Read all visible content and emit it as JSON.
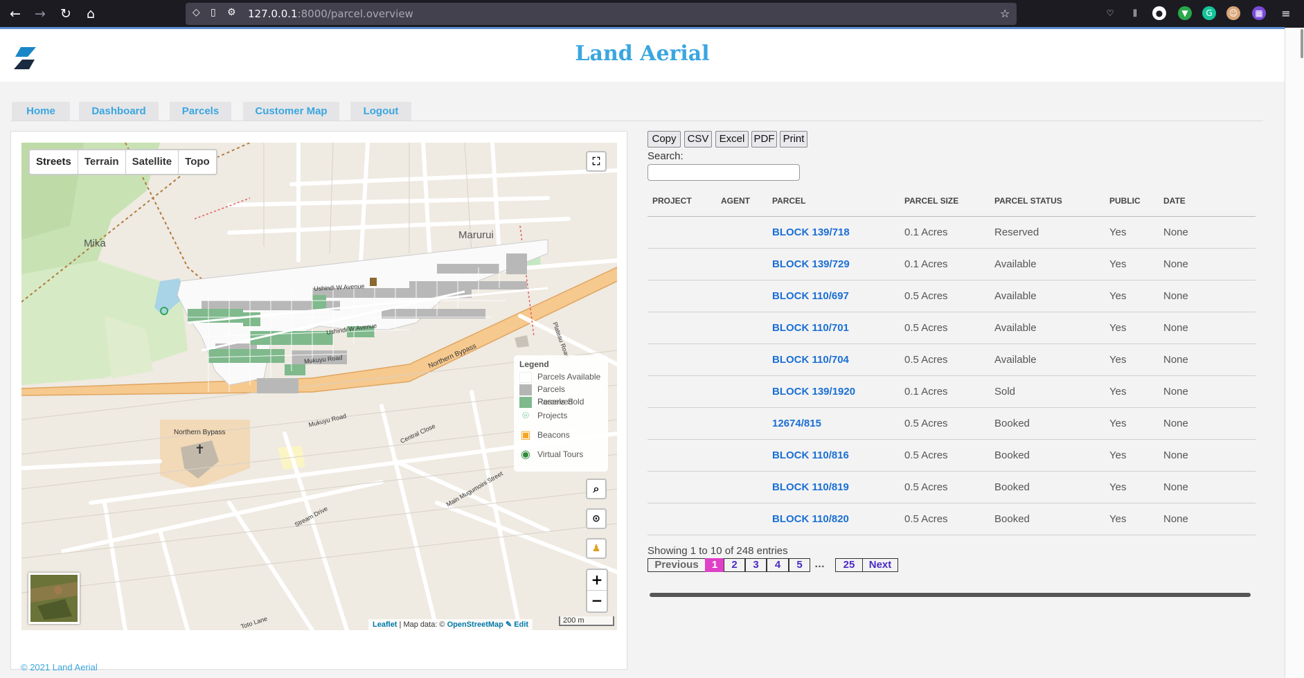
{
  "browser": {
    "url_host": "127.0.0.1",
    "url_rest": ":8000/parcel.overview"
  },
  "site": {
    "title": "Land Aerial",
    "footer": "© 2021 Land Aerial",
    "accent_color": "#3aa6e0"
  },
  "nav": {
    "items": [
      {
        "label": "Home"
      },
      {
        "label": "Dashboard"
      },
      {
        "label": "Parcels"
      },
      {
        "label": "Customer Map"
      },
      {
        "label": "Logout"
      }
    ]
  },
  "map": {
    "layers": [
      "Streets",
      "Terrain",
      "Satellite",
      "Topo"
    ],
    "active_layer": "Streets",
    "labels": {
      "mika": "Mika",
      "marurui": "Marurui",
      "northern_bypass_1": "Northern Bypass",
      "northern_bypass_2": "Northern Bypass",
      "ushindi_1": "Ushindi W Avenue",
      "ushindi_2": "Ushindi W Avenue",
      "mukuyu_1": "Mukuyu Road",
      "mukuyu_2": "Mukuyu Road",
      "central_close": "Central Close",
      "stream_drive": "Stream Drive",
      "main_mugumoini": "Main Mugumoini Street",
      "plateau": "Plateau Road",
      "toto_lane": "Toto Lane"
    },
    "legend": {
      "title": "Legend",
      "items": [
        {
          "label": "Parcels Available",
          "color": "#ffffff"
        },
        {
          "label": "Parcels Reserved",
          "color": "#b5b5b5"
        },
        {
          "label": "Parcels Sold",
          "color": "#7fb98c"
        },
        {
          "label": "Projects",
          "icon": "map-pin-icon"
        },
        {
          "label": "Beacons",
          "icon": "beacon-icon"
        },
        {
          "label": "Virtual Tours",
          "icon": "tour-icon"
        }
      ]
    },
    "attribution": {
      "leaflet": "Leaflet",
      "mid": " | Map data: © ",
      "osm": "OpenStreetMap",
      "edit": " ✎ Edit"
    },
    "scale": "200 m",
    "zoom_in": "+",
    "zoom_out": "−"
  },
  "toolbar": {
    "buttons": [
      "Copy",
      "CSV",
      "Excel",
      "PDF",
      "Print"
    ],
    "search_label": "Search:",
    "search_value": ""
  },
  "table": {
    "columns": [
      "PROJECT",
      "AGENT",
      "PARCEL",
      "PARCEL SIZE",
      "PARCEL STATUS",
      "PUBLIC",
      "DATE"
    ],
    "rows": [
      {
        "project": "",
        "agent": "",
        "parcel": "BLOCK 139/718",
        "size": "0.1 Acres",
        "status": "Reserved",
        "public": "Yes",
        "date": "None"
      },
      {
        "project": "",
        "agent": "",
        "parcel": "BLOCK 139/729",
        "size": "0.1 Acres",
        "status": "Available",
        "public": "Yes",
        "date": "None"
      },
      {
        "project": "",
        "agent": "",
        "parcel": "BLOCK 110/697",
        "size": "0.5 Acres",
        "status": "Available",
        "public": "Yes",
        "date": "None"
      },
      {
        "project": "",
        "agent": "",
        "parcel": "BLOCK 110/701",
        "size": "0.5 Acres",
        "status": "Available",
        "public": "Yes",
        "date": "None"
      },
      {
        "project": "",
        "agent": "",
        "parcel": "BLOCK 110/704",
        "size": "0.5 Acres",
        "status": "Available",
        "public": "Yes",
        "date": "None"
      },
      {
        "project": "",
        "agent": "",
        "parcel": "BLOCK 139/1920",
        "size": "0.1 Acres",
        "status": "Sold",
        "public": "Yes",
        "date": "None"
      },
      {
        "project": "",
        "agent": "",
        "parcel": "12674/815",
        "size": "0.5 Acres",
        "status": "Booked",
        "public": "Yes",
        "date": "None"
      },
      {
        "project": "",
        "agent": "",
        "parcel": "BLOCK 110/816",
        "size": "0.5 Acres",
        "status": "Booked",
        "public": "Yes",
        "date": "None"
      },
      {
        "project": "",
        "agent": "",
        "parcel": "BLOCK 110/819",
        "size": "0.5 Acres",
        "status": "Booked",
        "public": "Yes",
        "date": "None"
      },
      {
        "project": "",
        "agent": "",
        "parcel": "BLOCK 110/820",
        "size": "0.5 Acres",
        "status": "Booked",
        "public": "Yes",
        "date": "None"
      }
    ]
  },
  "pagination": {
    "info": "Showing 1 to 10 of 248 entries",
    "previous": "Previous",
    "pages": [
      "1",
      "2",
      "3",
      "4",
      "5"
    ],
    "ellipsis": "…",
    "last": "25",
    "next": "Next",
    "current": "1",
    "active_color": "#e040c8"
  }
}
